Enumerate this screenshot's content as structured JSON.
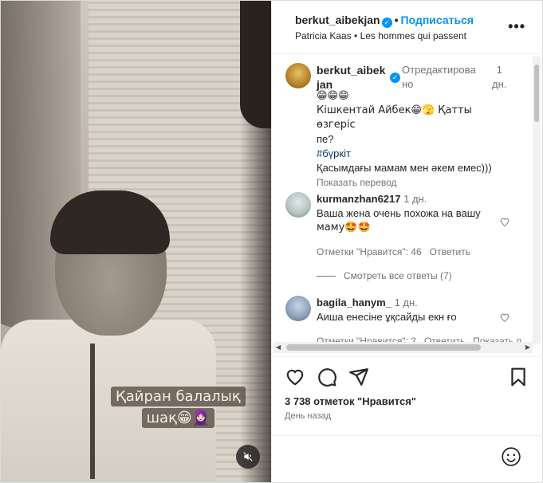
{
  "media": {
    "overlay_line1": "Қайран балалық",
    "overlay_line2": "шақ😁🧕🏻"
  },
  "header": {
    "username": "berkut_aibekjan",
    "follow_label": "Подписаться",
    "music": "Patricia Kaas • Les hommes qui passent",
    "more_label": "•••"
  },
  "caption": {
    "username_line1": "berkut_aibek",
    "username_line2": "jan",
    "edited": "Отредактирова",
    "edited_line2": "но",
    "time": "1",
    "time_line2": "дн.",
    "line1": "😁😁😁",
    "line2": "Кішкентай Айбек😁🫣 Қатты өзгеріс",
    "line3": "пе?",
    "hashtag": "#бүркіт",
    "line4": "Қасымдағы мамам мен әкем емес)))",
    "translate": "Показать перевод"
  },
  "comments": [
    {
      "username": "kurmanzhan6217",
      "time": "1 дн.",
      "text_line1": "Ваша жена очень похожа на вашу",
      "text_line2": "маму🤩🤩",
      "likes": "Отметки \"Нравится\": 46",
      "reply": "Ответить"
    },
    {
      "username": "bagila_hanym_",
      "time": "1 дн.",
      "text_line1": "Аиша енесіне ұқсайды екн ғо",
      "likes": "Отметки \"Нравится\": 2",
      "reply": "Ответить",
      "translate": "Показать п"
    }
  ],
  "view_replies": "Смотреть все ответы (7)",
  "footer": {
    "likes_count": "3 738 отметок \"Нравится\"",
    "date": "День назад"
  }
}
